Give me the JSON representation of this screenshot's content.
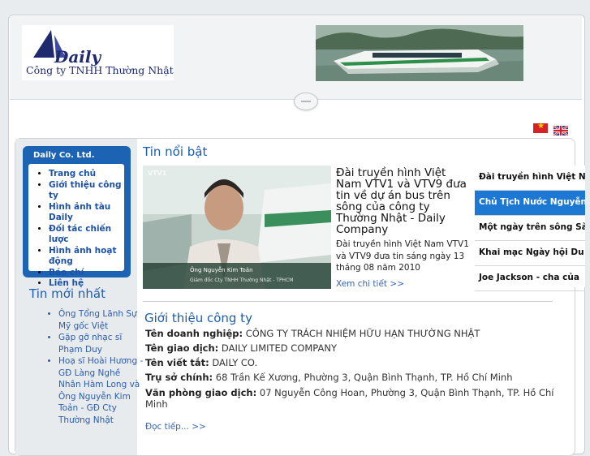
{
  "header": {
    "company_name": "Công ty TNHH Thường Nhật",
    "logo_wordmark": "Daily"
  },
  "language_flags": [
    "vietnamese-flag-icon",
    "english-flag-icon"
  ],
  "sidebar": {
    "menu_title": "Daily Co. Ltd.",
    "menu_items": [
      {
        "label": "Trang chủ"
      },
      {
        "label": "Giới thiệu công ty"
      },
      {
        "label": "Hình ảnh tàu Daily"
      },
      {
        "label": "Đối tác chiến lược"
      },
      {
        "label": "Hình ảnh hoạt động"
      },
      {
        "label": "Báo chí"
      },
      {
        "label": "Liên hệ"
      }
    ],
    "latest_title": "Tin mới nhất",
    "latest_items": [
      {
        "label": "Ông Tổng Lãnh Sự Mỹ gốc Việt"
      },
      {
        "label": "Gặp gỡ nhạc sĩ Phạm Duy"
      },
      {
        "label": "Hoạ sĩ Hoài Hương - GĐ Làng Nghề Nhân Hàm Long và Ông Nguyễn Kim Toản - GĐ Cty Thường Nhật"
      }
    ]
  },
  "featured": {
    "section_title": "Tin nổi bật",
    "photo_caption_name": "Ông Nguyễn Kim Toản",
    "photo_caption_role": "Giám đốc Cty TNHH Thường Nhật - TPHCM",
    "photo_channel": "VTV1",
    "headline": "Đài truyền hình Việt Nam VTV1 và VTV9 đưa tin về dự án bus trên sông của công ty Thường Nhật - Daily Company",
    "summary": "Đài truyền hình Việt Nam VTV1 và VTV9 đưa tin sáng ngày 13 tháng 08 năm 2010",
    "more_label": "Xem chi tiết",
    "more_arrow": ">>",
    "tabs": [
      {
        "label": "Đài truyền hình Việt Nam",
        "active": false
      },
      {
        "label": "Chủ Tịch Nước Nguyễn",
        "active": true
      },
      {
        "label": "Một ngày trên sông Sài",
        "active": false
      },
      {
        "label": "Khai mạc Ngày hội Du",
        "active": false
      },
      {
        "label": "Joe Jackson - cha của",
        "active": false
      }
    ]
  },
  "intro": {
    "title": "Giới thiệu công ty",
    "rows": [
      {
        "label": "Tên doanh nghiệp:",
        "value": "CÔNG TY TRÁCH NHIỆM HỮU HẠN THƯỜNG NHẬT"
      },
      {
        "label": "Tên giao dịch:",
        "value": "DAILY LIMITED COMPANY"
      },
      {
        "label": "Tên viết tắt:",
        "value": "DAILY CO."
      },
      {
        "label": "Trụ sở chính:",
        "value": "68 Trần Kế Xương, Phường 3, Quận Bình Thạnh, TP. Hồ Chí Minh"
      },
      {
        "label": "Văn phòng giao dịch:",
        "value": "07 Nguyễn Công Hoan, Phường 3, Quận Bình Thạnh, TP. Hồ Chí Minh"
      }
    ],
    "read_more": "Đọc tiếp...",
    "read_more_arrow": ">>"
  },
  "colors": {
    "accent_blue": "#1d63b3",
    "active_tab": "#1d78d4",
    "heading_blue": "#1d5dab"
  }
}
